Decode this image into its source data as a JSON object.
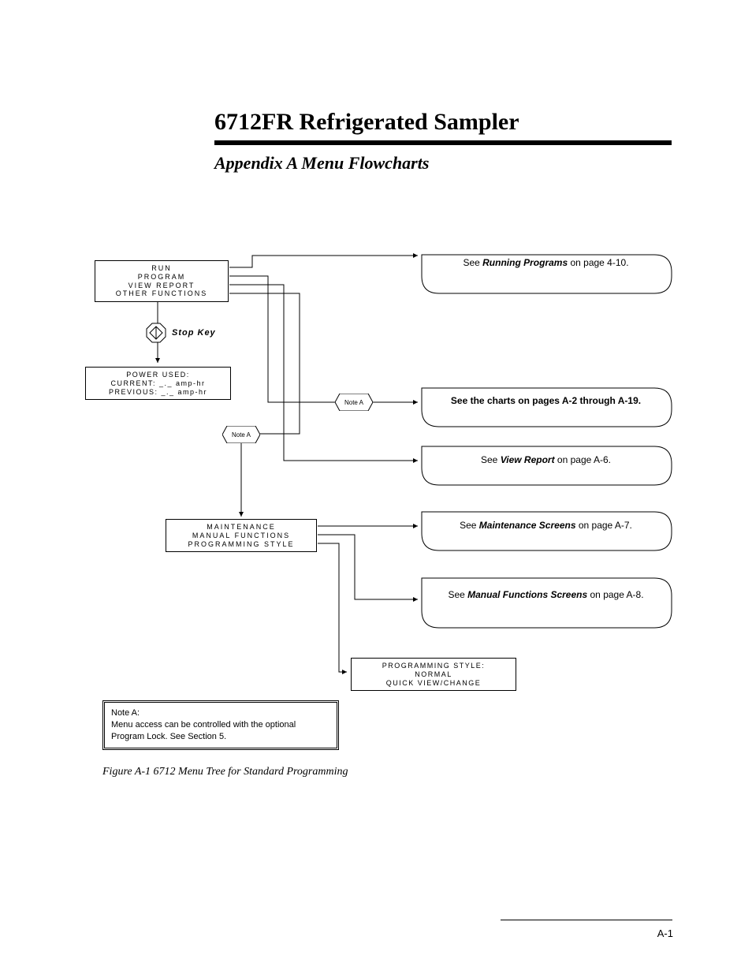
{
  "header": {
    "title": "6712FR Refrigerated Sampler",
    "subtitle": "Appendix A  Menu Flowcharts"
  },
  "boxes": {
    "main_menu": {
      "l1": "RUN",
      "l2": "PROGRAM",
      "l3": "VIEW REPORT",
      "l4": "OTHER FUNCTIONS"
    },
    "power": {
      "l1": "POWER USED:",
      "l2": "CURRENT: _._ amp-hr",
      "l3": "PREVIOUS: _._ amp-hr"
    },
    "other": {
      "l1": "MAINTENANCE",
      "l2": "MANUAL FUNCTIONS",
      "l3": "PROGRAMMING STYLE"
    },
    "progstyle": {
      "l1": "PROGRAMMING STYLE:",
      "l2": "NORMAL",
      "l3": "QUICK VIEW/CHANGE"
    },
    "noteA_label": "Note A",
    "noteA_box": {
      "heading": "Note A:",
      "text": "Menu access can be controlled with the optional Program Lock. See Section 5."
    }
  },
  "stop_key": "Stop Key",
  "callouts": {
    "running": {
      "pre": "See ",
      "em": "Running Programs",
      "post": " on page 4-10."
    },
    "charts": {
      "text": "See the charts on pages A-2 through A-19."
    },
    "view": {
      "pre": "See ",
      "em": "View Report",
      "post": " on page A-6."
    },
    "maint": {
      "pre": "See ",
      "em": "Maintenance Screens",
      "post": " on page A-7."
    },
    "manual": {
      "pre": "See ",
      "em": "Manual Functions Screens",
      "post": " on page A-8."
    }
  },
  "caption": "Figure A-1  6712 Menu Tree for Standard Programming",
  "page_number": "A-1"
}
